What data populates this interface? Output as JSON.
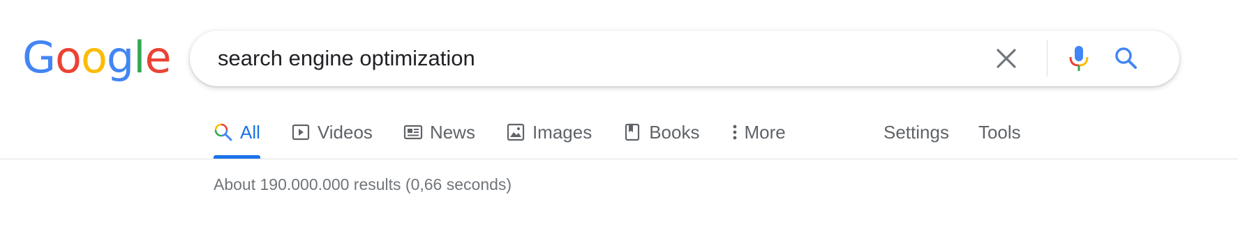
{
  "logo": {
    "letters": [
      "G",
      "o",
      "o",
      "g",
      "l",
      "e"
    ],
    "colors": [
      "#4285f4",
      "#ea4335",
      "#fbbc05",
      "#4285f4",
      "#34a853",
      "#ea4335"
    ]
  },
  "search": {
    "query": "search engine optimization",
    "clear_icon": "close-icon",
    "mic_icon": "microphone-icon",
    "submit_icon": "search-icon"
  },
  "tabs": [
    {
      "label": "All",
      "icon": "search-icon",
      "active": true
    },
    {
      "label": "Videos",
      "icon": "play-icon",
      "active": false
    },
    {
      "label": "News",
      "icon": "newspaper-icon",
      "active": false
    },
    {
      "label": "Images",
      "icon": "image-icon",
      "active": false
    },
    {
      "label": "Books",
      "icon": "book-icon",
      "active": false
    },
    {
      "label": "More",
      "icon": "more-vert-icon",
      "active": false
    }
  ],
  "right_tabs": [
    {
      "label": "Settings"
    },
    {
      "label": "Tools"
    }
  ],
  "results": {
    "stats": "About 190.000.000 results (0,66 seconds)"
  },
  "colors": {
    "accent": "#1a73e8",
    "muted": "#5f6368",
    "stats": "#70757a"
  }
}
